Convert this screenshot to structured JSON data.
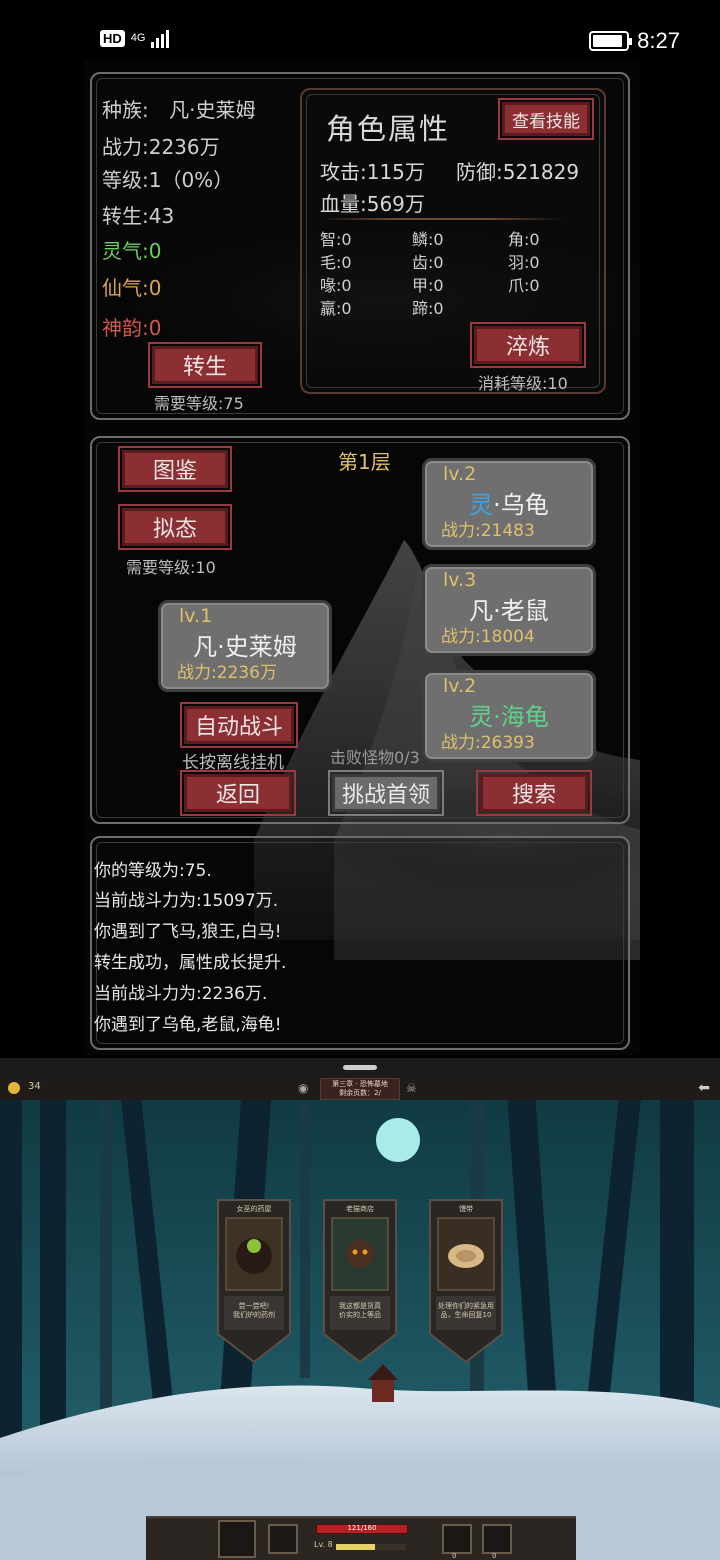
{
  "status_bar": {
    "hd": "HD",
    "network": "4G",
    "time": "8:27",
    "battery_level": 0.9
  },
  "character": {
    "race_label": "种族:",
    "race_value": "凡·史莱姆",
    "power": "战力:2236万",
    "level": "等级:1（0%）",
    "rebirth": "转生:43",
    "lingqi": "灵气:0",
    "xianqi": "仙气:0",
    "shenyun": "神韵:0",
    "rebirth_button": "转生",
    "rebirth_requirement": "需要等级:75"
  },
  "attributes": {
    "title": "角色属性",
    "view_skills_button": "查看技能",
    "attack": "攻击:115万",
    "defense": "防御:521829",
    "hp": "血量:569万",
    "small": [
      [
        "智:0",
        "鳞:0",
        "角:0"
      ],
      [
        "毛:0",
        "齿:0",
        "羽:0"
      ],
      [
        "喙:0",
        "甲:0",
        "爪:0"
      ],
      [
        "羸:0",
        "蹄:0",
        ""
      ]
    ],
    "refine_button": "淬炼",
    "refine_cost": "消耗等级:10"
  },
  "battle": {
    "floor": "第1层",
    "codex_button": "图鉴",
    "mimic_button": "拟态",
    "mimic_requirement": "需要等级:10",
    "player": {
      "level": "lv.1",
      "rank": "凡",
      "name": "·史莱姆",
      "power": "战力:2236万"
    },
    "monsters": [
      {
        "level": "lv.2",
        "rank": "灵",
        "name": "·乌龟",
        "power": "战力:21483"
      },
      {
        "level": "lv.3",
        "rank": "凡",
        "name": "·老鼠",
        "power": "战力:18004"
      },
      {
        "level": "lv.2",
        "rank": "灵",
        "name": "·海龟",
        "power": "战力:26393"
      }
    ],
    "auto_battle_button": "自动战斗",
    "auto_battle_hint": "长按离线挂机",
    "defeat_count": "击败怪物0/3",
    "back_button": "返回",
    "boss_button": "挑战首领",
    "search_button": "搜索"
  },
  "log": [
    "你的等级为:75.",
    "当前战斗力为:15097万.",
    "你遇到了飞马,狼王,白马!",
    "转生成功，属性成长提升.",
    "当前战斗力为:2236万.",
    "你遇到了乌龟,老鼠,海龟!"
  ],
  "second_game": {
    "coins": "34",
    "chapter": "第三章 · 恐怖墓地",
    "chapter_sub": "剩余页数：2/",
    "cards": [
      {
        "title": "女巫的药屋",
        "desc": "尝一尝吧!\n我们炉的药剂"
      },
      {
        "title": "老猫商店",
        "desc": "我这都是货真\n价实的上等品"
      },
      {
        "title": "馒带",
        "desc": "处理你们的紧急用\n品，生命回复10"
      }
    ],
    "hp_text": "121/160",
    "level": "Lv. 8",
    "xp_fraction": 0.55,
    "slot_counts": [
      "0",
      "0"
    ],
    "colors": {
      "sky": "#1d5560",
      "snow": "#dbe6ee",
      "moon": "#a8ecea"
    }
  },
  "colors": {
    "red_button": "#8b2f33",
    "gold": "#e0c06a",
    "green": "#6fcf5d"
  }
}
